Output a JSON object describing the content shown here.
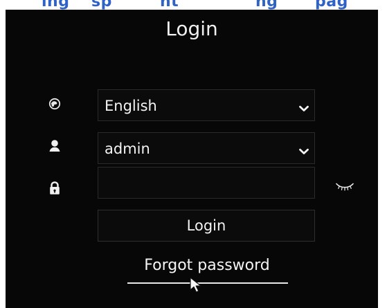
{
  "header": {
    "fragments": [
      "ing",
      "sp",
      "nt",
      "ng",
      "pag"
    ]
  },
  "login": {
    "title": "Login",
    "language_value": "English",
    "user_value": "admin",
    "password_placeholder": "",
    "button_label": "Login",
    "forgot_link": "Forgot password"
  },
  "icons": {
    "language": "globe-icon",
    "user": "user-icon",
    "password": "lock-icon",
    "dropdown": "chevron-down-icon",
    "visibility": "eye-closed-icon",
    "cursor": "mouse-cursor-icon"
  },
  "colors": {
    "screen_background": "#070707",
    "text": "#f3f3f3",
    "field_border": "#2a2a2a",
    "header_link": "#2f62c7"
  }
}
